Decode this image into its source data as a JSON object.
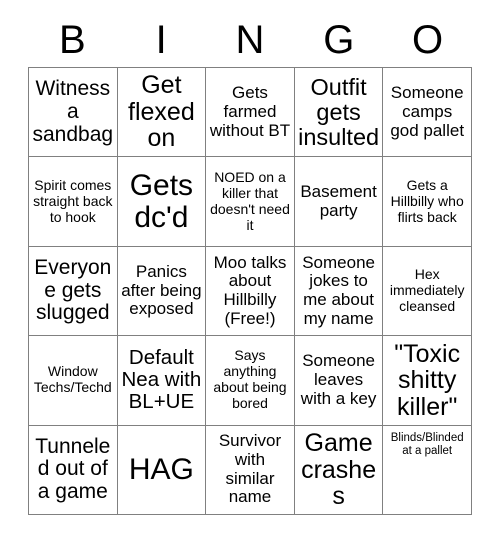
{
  "card": {
    "title": "BINGO",
    "header_letters": [
      "B",
      "I",
      "N",
      "G",
      "O"
    ],
    "columns": 5,
    "rows": 5,
    "colors": {
      "text": "#000000",
      "grid_line": "#808080",
      "cell_background": "#ffffff",
      "page_background": "#ffffff"
    }
  },
  "cells": [
    {
      "text": "Witness a sandbag",
      "size": "lg",
      "align": "center"
    },
    {
      "text": "Get flexed on",
      "size": "xl",
      "align": "center"
    },
    {
      "text": "Gets farmed without BT",
      "size": "md",
      "align": "center"
    },
    {
      "text": "Outfit gets insulted",
      "size": "xl",
      "align": "center"
    },
    {
      "text": "Someone camps god pallet",
      "size": "md",
      "align": "center"
    },
    {
      "text": "Spirit comes straight back to hook",
      "size": "sm",
      "align": "center"
    },
    {
      "text": "Gets dc'd",
      "size": "xxl",
      "align": "center"
    },
    {
      "text": "NOED on a killer that doesn't need it",
      "size": "sm",
      "align": "center"
    },
    {
      "text": "Basement party",
      "size": "md",
      "align": "center"
    },
    {
      "text": "Gets a Hillbilly who flirts back",
      "size": "sm",
      "align": "center"
    },
    {
      "text": "Everyone gets slugged",
      "size": "lg",
      "align": "center"
    },
    {
      "text": "Panics after being exposed",
      "size": "md",
      "align": "center"
    },
    {
      "text": "Moo talks about Hillbilly (Free!)",
      "size": "md",
      "align": "center"
    },
    {
      "text": "Someone jokes to me about my name",
      "size": "md",
      "align": "center"
    },
    {
      "text": "Hex immediately cleansed",
      "size": "sm",
      "align": "center"
    },
    {
      "text": "Window Techs/Techd",
      "size": "sm",
      "align": "center"
    },
    {
      "text": "Default Nea with BL+UE",
      "size": "lg",
      "align": "center"
    },
    {
      "text": "Says anything about being bored",
      "size": "sm",
      "align": "center"
    },
    {
      "text": "Someone leaves with a key",
      "size": "md",
      "align": "center"
    },
    {
      "text": "\"Toxic shitty killer\"",
      "size": "xl",
      "align": "center"
    },
    {
      "text": "Tunneled out of a game",
      "size": "lg",
      "align": "center"
    },
    {
      "text": "HAG",
      "size": "xxl",
      "align": "center"
    },
    {
      "text": "Survivor with similar name",
      "size": "md",
      "align": "center"
    },
    {
      "text": "Game crashes",
      "size": "xl",
      "align": "center"
    },
    {
      "text": "Blinds/Blinded at a pallet",
      "size": "xs",
      "align": "top"
    }
  ]
}
